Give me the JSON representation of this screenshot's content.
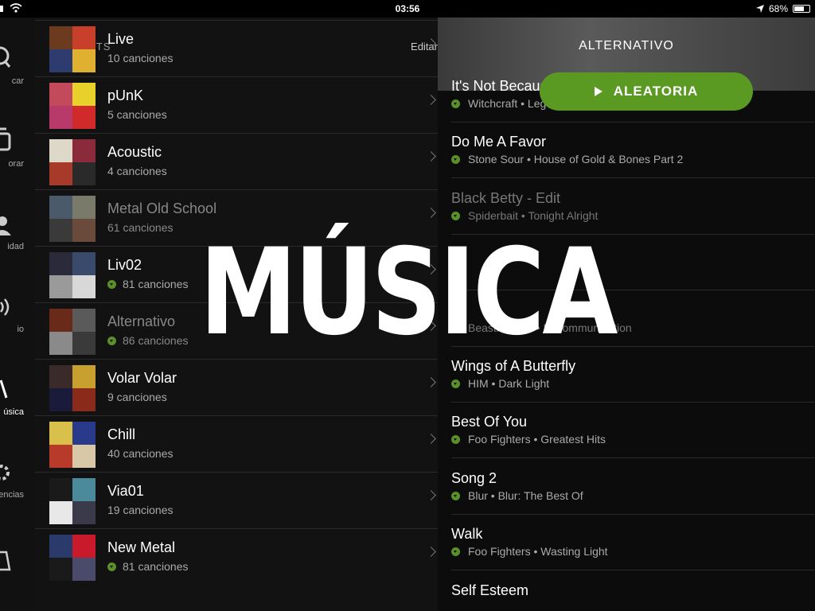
{
  "status_bar": {
    "time": "03:56",
    "battery": "68%",
    "battery_level": 0.68,
    "icons": [
      "signal-icon",
      "wifi-icon",
      "location-arrow-icon",
      "battery-icon"
    ]
  },
  "sidebar": {
    "items": [
      {
        "label": "car",
        "icon": "search-icon"
      },
      {
        "label": "orar",
        "icon": "browse-icon"
      },
      {
        "label": "idad",
        "icon": "person-icon"
      },
      {
        "label": "io",
        "icon": "radio-icon"
      },
      {
        "label": "úsica",
        "icon": "music-icon",
        "active": true
      },
      {
        "label": "encias",
        "icon": "gear-icon"
      },
      {
        "label": "",
        "icon": "bag-icon"
      }
    ]
  },
  "playlists": {
    "title": "PLAYLISTS",
    "edit_label": "Editar",
    "items": [
      {
        "name": "Live",
        "count": "10 canciones",
        "downloaded": false,
        "dim": false,
        "art": [
          "#6b3a1f",
          "#c8402a",
          "#2d3b6e",
          "#e0b030"
        ]
      },
      {
        "name": "pUnK",
        "count": "5 canciones",
        "downloaded": false,
        "dim": false,
        "art": [
          "#c24a5a",
          "#e8d12a",
          "#b83a6a",
          "#d02a2a"
        ]
      },
      {
        "name": "Acoustic",
        "count": "4 canciones",
        "downloaded": false,
        "dim": false,
        "art": [
          "#ddd8c8",
          "#8a2a3a",
          "#a83a2a",
          "#2a2a2a"
        ]
      },
      {
        "name": "Metal Old School",
        "count": "61 canciones",
        "downloaded": false,
        "dim": true,
        "art": [
          "#4a5a6a",
          "#7a7a6a",
          "#3a3a3a",
          "#6a4a3a"
        ]
      },
      {
        "name": "Liv02",
        "count": "81 canciones",
        "downloaded": true,
        "dim": false,
        "art": [
          "#2a2a3a",
          "#3a4a6a",
          "#9a9a9a",
          "#d8d8d8"
        ]
      },
      {
        "name": "Alternativo",
        "count": "86 canciones",
        "downloaded": true,
        "dim": true,
        "art": [
          "#6a2a1a",
          "#5a5a5a",
          "#8a8a8a",
          "#3a3a3a"
        ]
      },
      {
        "name": "Volar Volar",
        "count": "9 canciones",
        "downloaded": false,
        "dim": false,
        "art": [
          "#3a2a2a",
          "#c8a030",
          "#1a1a3a",
          "#8a2a1a"
        ]
      },
      {
        "name": "Chill",
        "count": "40 canciones",
        "downloaded": false,
        "dim": false,
        "art": [
          "#d8c04a",
          "#2a3a8a",
          "#b83a2a",
          "#d8c8a8"
        ]
      },
      {
        "name": "Via01",
        "count": "19 canciones",
        "downloaded": false,
        "dim": false,
        "art": [
          "#1a1a1a",
          "#4a8a9a",
          "#e8e8e8",
          "#3a3a4a"
        ]
      },
      {
        "name": "New Metal",
        "count": "81 canciones",
        "downloaded": true,
        "dim": false,
        "art": [
          "#2a3a6a",
          "#c81a2a",
          "#1a1a1a",
          "#4a4a6a"
        ]
      }
    ]
  },
  "playlist_detail": {
    "title": "ALTERNATIVO",
    "shuffle_label": "ALEATORIA",
    "tracks": [
      {
        "name": "It's Not Because Of You",
        "sub": "Witchcraft • Legend (Bonus Version)",
        "dim": false
      },
      {
        "name": "Do Me A Favor",
        "sub": "Stone Sour • House of Gold & Bones Part 2",
        "dim": false
      },
      {
        "name": "Black Betty - Edit",
        "sub": "Spiderbait • Tonight Alright",
        "dim": true
      },
      {
        "name": "",
        "sub": "",
        "dim": false
      },
      {
        "name": "",
        "sub": "Beastie Boys • Ill Communication",
        "dim": true
      },
      {
        "name": "Wings of A Butterfly",
        "sub": "HIM • Dark Light",
        "dim": false
      },
      {
        "name": "Best Of You",
        "sub": "Foo Fighters • Greatest Hits",
        "dim": false
      },
      {
        "name": "Song 2",
        "sub": "Blur • Blur: The Best Of",
        "dim": false
      },
      {
        "name": "Walk",
        "sub": "Foo Fighters • Wasting Light",
        "dim": false
      },
      {
        "name": "Self Esteem",
        "sub": "",
        "dim": false
      }
    ]
  },
  "overlay": {
    "text": "MÚSICA"
  }
}
